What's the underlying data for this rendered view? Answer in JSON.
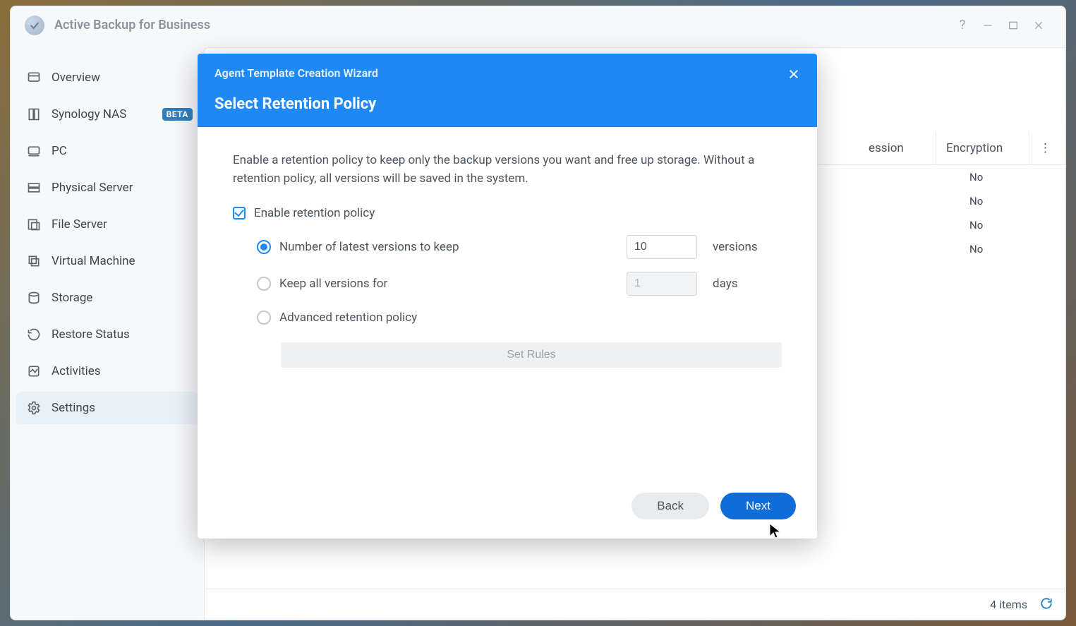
{
  "app_title": "Active Backup for Business",
  "titlebar": {
    "help_name": "help-icon",
    "min_name": "minimize-icon",
    "max_name": "maximize-icon",
    "close_name": "close-icon"
  },
  "sidebar": {
    "items": [
      {
        "label": "Overview",
        "icon": "overview-icon",
        "active": false,
        "badge": null
      },
      {
        "label": "Synology NAS",
        "icon": "nas-icon",
        "active": false,
        "badge": "BETA"
      },
      {
        "label": "PC",
        "icon": "pc-icon",
        "active": false,
        "badge": null
      },
      {
        "label": "Physical Server",
        "icon": "server-icon",
        "active": false,
        "badge": null
      },
      {
        "label": "File Server",
        "icon": "fileserver-icon",
        "active": false,
        "badge": null
      },
      {
        "label": "Virtual Machine",
        "icon": "vm-icon",
        "active": false,
        "badge": null
      },
      {
        "label": "Storage",
        "icon": "storage-icon",
        "active": false,
        "badge": null
      },
      {
        "label": "Restore Status",
        "icon": "restore-icon",
        "active": false,
        "badge": null
      },
      {
        "label": "Activities",
        "icon": "activities-icon",
        "active": false,
        "badge": null
      },
      {
        "label": "Settings",
        "icon": "settings-icon",
        "active": true,
        "badge": null
      }
    ]
  },
  "table": {
    "col_compression": "ession",
    "col_encryption": "Encryption",
    "rows": [
      {
        "encryption": "No"
      },
      {
        "encryption": "No"
      },
      {
        "encryption": "No"
      },
      {
        "encryption": "No"
      }
    ],
    "footer_count": "4 items"
  },
  "wizard": {
    "header_small": "Agent Template Creation Wizard",
    "header_big": "Select Retention Policy",
    "desc": "Enable a retention policy to keep only the backup versions you want and free up storage. Without a retention policy, all versions will be saved in the system.",
    "enable_label": "Enable retention policy",
    "enable_checked": true,
    "opt1_label": "Number of latest versions to keep",
    "opt1_value": "10",
    "opt1_suffix": "versions",
    "opt1_selected": true,
    "opt2_label": "Keep all versions for",
    "opt2_value": "1",
    "opt2_suffix": "days",
    "opt2_selected": false,
    "opt3_label": "Advanced retention policy",
    "opt3_selected": false,
    "set_rules_label": "Set Rules",
    "back_label": "Back",
    "next_label": "Next"
  }
}
